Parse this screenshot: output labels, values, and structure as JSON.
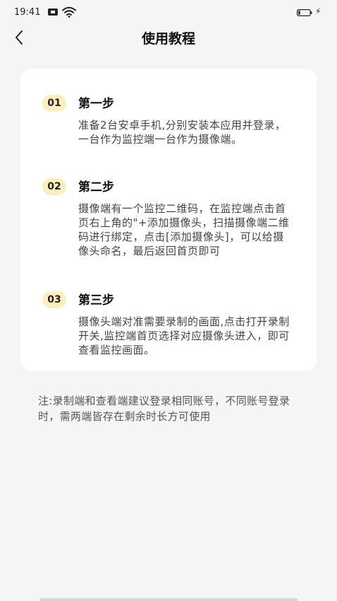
{
  "status_bar": {
    "time": "19:41",
    "charge_symbol": "⚡"
  },
  "header": {
    "title": "使用教程"
  },
  "steps": [
    {
      "number": "01",
      "title": "第一步",
      "description": "准备2台安卓手机,分别安装本应用并登录，一台作为监控端一台作为摄像端。"
    },
    {
      "number": "02",
      "title": "第二步",
      "description": "摄像端有一个监控二维码，在监控端点击首页右上角的\"+添加摄像头，扫描摄像端二维码进行绑定，点击[添加摄像头]，可以给摄像头命名，最后返回首页即可"
    },
    {
      "number": "03",
      "title": "第三步",
      "description": "摄像头端对准需要录制的画面,点击打开录制开关,监控端首页选择对应摄像头进入，即可查看监控画面。"
    }
  ],
  "note": "注:录制端和查看端建议登录相同账号，不同账号登录时，需两端皆存在剩余时长方可使用",
  "colors": {
    "background": "#f5f5f5",
    "card": "#ffffff",
    "badge": "#fdeec0"
  }
}
